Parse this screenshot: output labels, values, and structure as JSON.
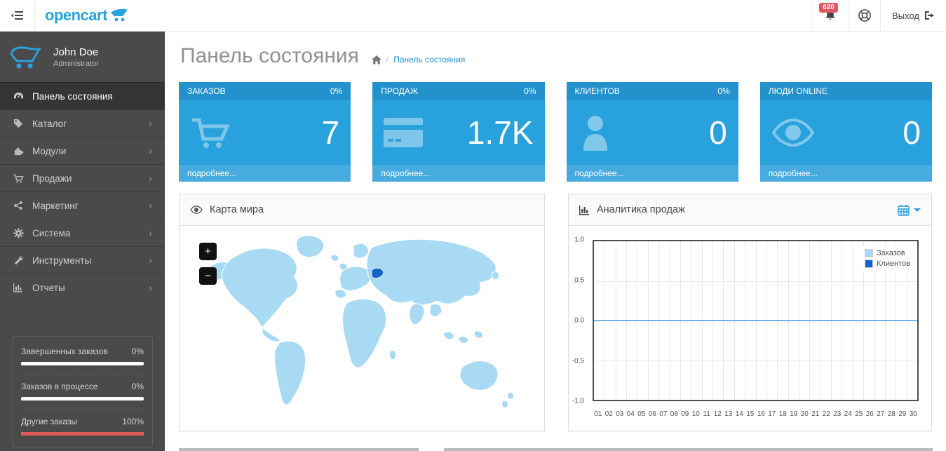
{
  "header": {
    "brand": "opencart",
    "notifications_count": "620",
    "logout_label": "Выход"
  },
  "user_panel": {
    "name": "John Doe",
    "role": "Administrator"
  },
  "sidebar": {
    "items": [
      {
        "label": "Панель состояния",
        "icon": "dashboard-icon",
        "active": true,
        "has_submenu": false
      },
      {
        "label": "Каталог",
        "icon": "tag-icon",
        "active": false,
        "has_submenu": true
      },
      {
        "label": "Модули",
        "icon": "puzzle-icon",
        "active": false,
        "has_submenu": true
      },
      {
        "label": "Продажи",
        "icon": "cart-icon",
        "active": false,
        "has_submenu": true
      },
      {
        "label": "Маркетинг",
        "icon": "share-icon",
        "active": false,
        "has_submenu": true
      },
      {
        "label": "Система",
        "icon": "gear-icon",
        "active": false,
        "has_submenu": true
      },
      {
        "label": "Инструменты",
        "icon": "wrench-icon",
        "active": false,
        "has_submenu": true
      },
      {
        "label": "Отчеты",
        "icon": "bar-chart-icon",
        "active": false,
        "has_submenu": true
      }
    ],
    "chevron": "›"
  },
  "sidebar_stats": [
    {
      "label": "Завершенных заказов",
      "value": "0%",
      "fill": 0,
      "fill_color": "#e25b5b",
      "track_color": "#ffffff"
    },
    {
      "label": "Заказов в процессе",
      "value": "0%",
      "fill": 0,
      "fill_color": "#e25b5b",
      "track_color": "#ffffff"
    },
    {
      "label": "Другие заказы",
      "value": "100%",
      "fill": 100,
      "fill_color": "#e25b5b",
      "track_color": "#ffffff"
    }
  ],
  "page": {
    "title": "Панель состояния",
    "breadcrumb_sep": "/",
    "breadcrumb": "Панель состояния"
  },
  "tiles": [
    {
      "label": "ЗАКАЗОВ",
      "percent": "0%",
      "value": "7",
      "link": "подробнее...",
      "icon": "cart-icon"
    },
    {
      "label": "ПРОДАЖ",
      "percent": "0%",
      "value": "1.7K",
      "link": "подробнее...",
      "icon": "credit-card-icon"
    },
    {
      "label": "КЛИЕНТОВ",
      "percent": "0%",
      "value": "0",
      "link": "подробнее...",
      "icon": "user-icon"
    },
    {
      "label": "ЛЮДИ ONLINE",
      "percent": "",
      "value": "0",
      "link": "подробнее...",
      "icon": "eye-icon"
    }
  ],
  "map_panel": {
    "title": "Карта мира",
    "zoom_in": "+",
    "zoom_out": "−"
  },
  "chart_panel": {
    "title": "Аналитика продаж"
  },
  "chart_data": {
    "type": "line",
    "title": "Аналитика продаж",
    "x": [
      "01",
      "02",
      "03",
      "04",
      "05",
      "06",
      "07",
      "08",
      "09",
      "10",
      "11",
      "12",
      "13",
      "14",
      "15",
      "16",
      "17",
      "18",
      "19",
      "20",
      "21",
      "22",
      "23",
      "24",
      "25",
      "26",
      "27",
      "28",
      "29",
      "30"
    ],
    "series": [
      {
        "name": "Заказов",
        "color": "#a9d6f3",
        "line_color": "#72b4e9",
        "values": [
          0,
          0,
          0,
          0,
          0,
          0,
          0,
          0,
          0,
          0,
          0,
          0,
          0,
          0,
          0,
          0,
          0,
          0,
          0,
          0,
          0,
          0,
          0,
          0,
          0,
          0,
          0,
          0,
          0,
          0
        ]
      },
      {
        "name": "Клиентов",
        "color": "#0f64c8",
        "line_color": "#0f64c8",
        "values": [
          0,
          0,
          0,
          0,
          0,
          0,
          0,
          0,
          0,
          0,
          0,
          0,
          0,
          0,
          0,
          0,
          0,
          0,
          0,
          0,
          0,
          0,
          0,
          0,
          0,
          0,
          0,
          0,
          0,
          0
        ]
      }
    ],
    "ylim": [
      -1,
      1
    ],
    "yticks": [
      "1.0",
      "0.5",
      "0.0",
      "-0.5",
      "-1.0"
    ],
    "grid": true,
    "legend_position": "top-right"
  },
  "colors": {
    "accent_blue": "#29a1dc",
    "tile_head": "#2391cb",
    "tile_foot": "#47abe0",
    "sidebar_bg": "#4a4a4a",
    "badge_red": "#e4565f",
    "progress_red": "#e25b5b",
    "map_land": "#a9daf3",
    "map_highlight": "#1266c8",
    "link_blue": "#1e91cf"
  }
}
